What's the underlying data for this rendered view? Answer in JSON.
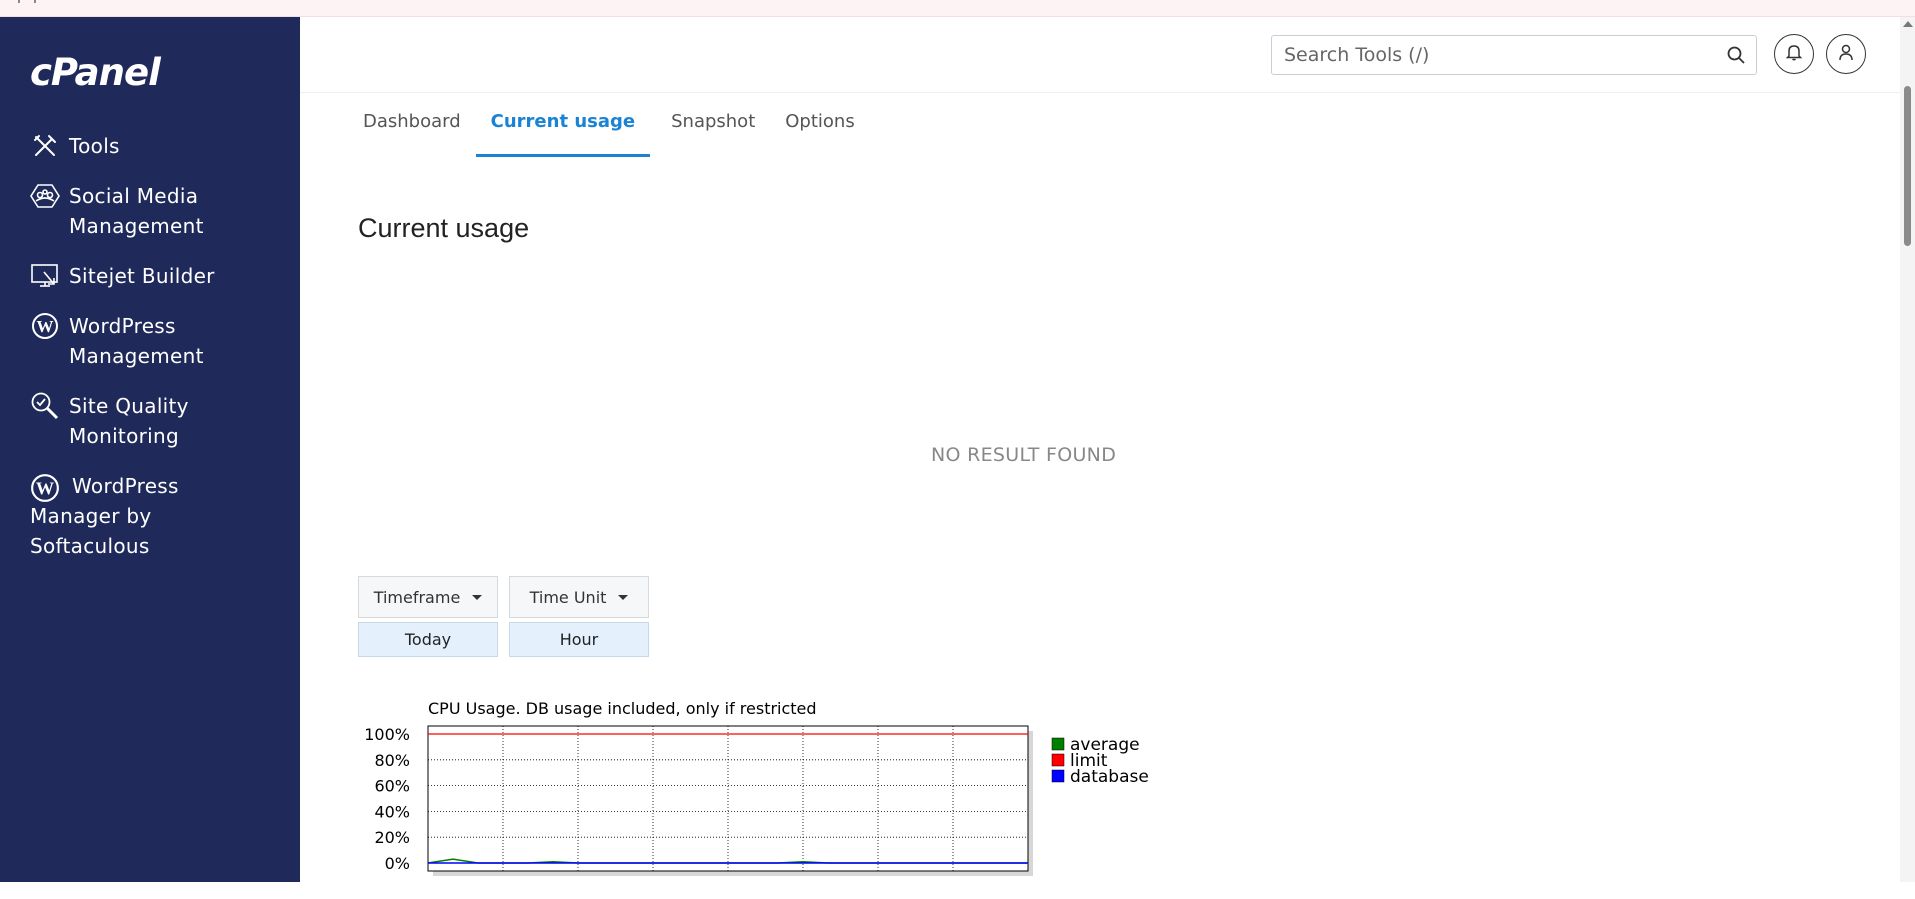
{
  "app": {
    "logo": "cPanel"
  },
  "sidebar": {
    "items": [
      {
        "label": "Tools",
        "icon": "tools-icon"
      },
      {
        "label": "Social Media Management",
        "icon": "social-media-icon"
      },
      {
        "label": "Sitejet Builder",
        "icon": "sitejet-icon"
      },
      {
        "label": "WordPress Management",
        "icon": "wordpress-icon"
      },
      {
        "label": "Site Quality Monitoring",
        "icon": "site-quality-icon"
      },
      {
        "label": "WordPress Manager by Softaculous",
        "icon": "wordpress-icon"
      }
    ]
  },
  "header": {
    "search_placeholder": "Search Tools (/)",
    "icons": [
      "search-icon",
      "bell-icon",
      "user-icon"
    ]
  },
  "tabs": [
    {
      "label": "Dashboard",
      "active": false
    },
    {
      "label": "Current usage",
      "active": true
    },
    {
      "label": "Snapshot",
      "active": false
    },
    {
      "label": "Options",
      "active": false
    }
  ],
  "main": {
    "title": "Current usage",
    "no_result": "NO RESULT FOUND",
    "timeframe": {
      "label": "Timeframe",
      "value": "Today"
    },
    "time_unit": {
      "label": "Time Unit",
      "value": "Hour"
    }
  },
  "colors": {
    "sidebar_bg": "#1f2a5a",
    "accent": "#1a83d4",
    "average": "#008000",
    "limit": "#ff0000",
    "database": "#0000ff"
  },
  "chart_data": {
    "type": "line",
    "title": "CPU Usage. DB usage included, only if restricted",
    "xlabel": "",
    "ylabel": "",
    "ylim": [
      0,
      100
    ],
    "yticks": [
      "100%",
      "80%",
      "60%",
      "40%",
      "20%",
      "0%"
    ],
    "grid": true,
    "legend_position": "right",
    "x": [
      0,
      1,
      2,
      3,
      4,
      5,
      6,
      7,
      8,
      9,
      10,
      11,
      12,
      13,
      14,
      15,
      16,
      17,
      18,
      19,
      20,
      21,
      22,
      23,
      24
    ],
    "series": [
      {
        "name": "average",
        "color": "#008000",
        "values": [
          0,
          3,
          0,
          0,
          0,
          1,
          0,
          0,
          0,
          0,
          0,
          0,
          0,
          0,
          0,
          1,
          0,
          0,
          0,
          0,
          0,
          0,
          0,
          0,
          0
        ]
      },
      {
        "name": "limit",
        "color": "#ff0000",
        "values": [
          100,
          100,
          100,
          100,
          100,
          100,
          100,
          100,
          100,
          100,
          100,
          100,
          100,
          100,
          100,
          100,
          100,
          100,
          100,
          100,
          100,
          100,
          100,
          100,
          100
        ]
      },
      {
        "name": "database",
        "color": "#0000ff",
        "values": [
          0,
          0,
          0,
          0,
          0,
          0,
          0,
          0,
          0,
          0,
          0,
          0,
          0,
          0,
          0,
          0,
          0,
          0,
          0,
          0,
          0,
          0,
          0,
          0,
          0
        ]
      }
    ]
  }
}
